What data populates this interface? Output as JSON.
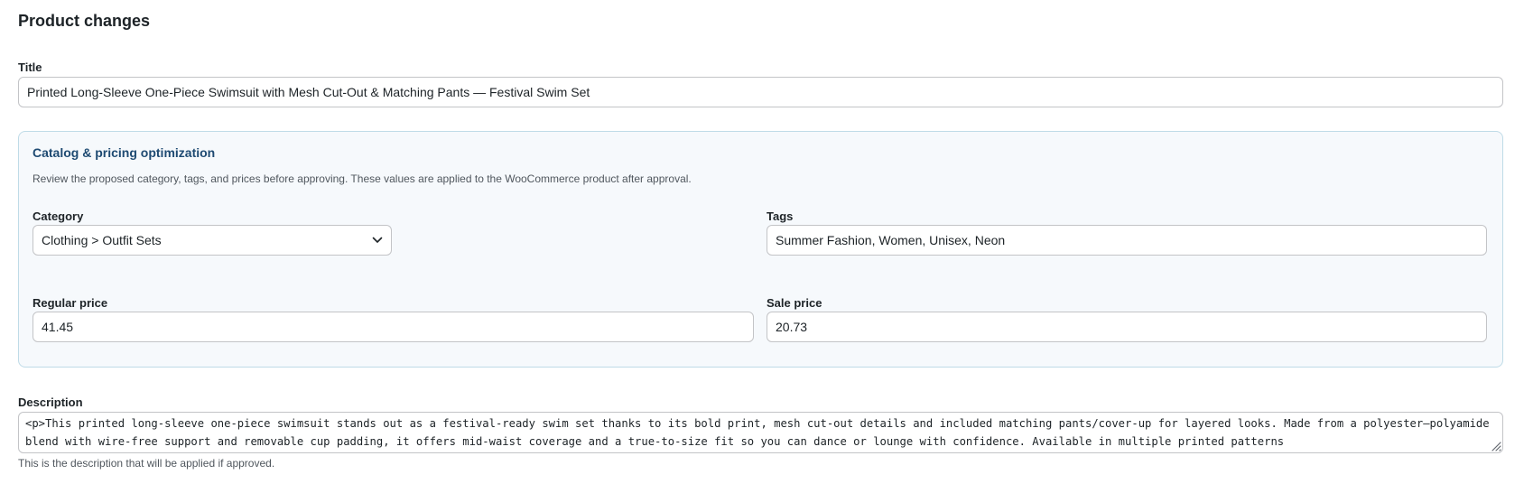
{
  "page": {
    "title": "Product changes"
  },
  "title_field": {
    "label": "Title",
    "value": "Printed Long-Sleeve One-Piece Swimsuit with Mesh Cut-Out & Matching Pants — Festival Swim Set"
  },
  "catalog": {
    "heading": "Catalog & pricing optimization",
    "description": "Review the proposed category, tags, and prices before approving. These values are applied to the WooCommerce product after approval.",
    "category": {
      "label": "Category",
      "value": "Clothing > Outfit Sets"
    },
    "tags": {
      "label": "Tags",
      "value": "Summer Fashion, Women, Unisex, Neon"
    },
    "regular_price": {
      "label": "Regular price",
      "value": "41.45"
    },
    "sale_price": {
      "label": "Sale price",
      "value": "20.73"
    }
  },
  "description_field": {
    "label": "Description",
    "value": "<p>This printed long-sleeve one-piece swimsuit stands out as a festival-ready swim set thanks to its bold print, mesh cut-out details and included matching pants/cover-up for layered looks. Made from a polyester–polyamide blend with wire-free support and removable cup padding, it offers mid-waist coverage and a true-to-size fit so you can dance or lounge with confidence. Available in multiple printed patterns",
    "help": "This is the description that will be applied if approved."
  },
  "icons": {
    "select_arrow": "chevron-down-icon",
    "resize": "resize-handle-icon"
  },
  "colors": {
    "panel_bg": "#f6f9fc",
    "panel_border": "#bfdbe7",
    "panel_heading": "#1e4a72"
  }
}
